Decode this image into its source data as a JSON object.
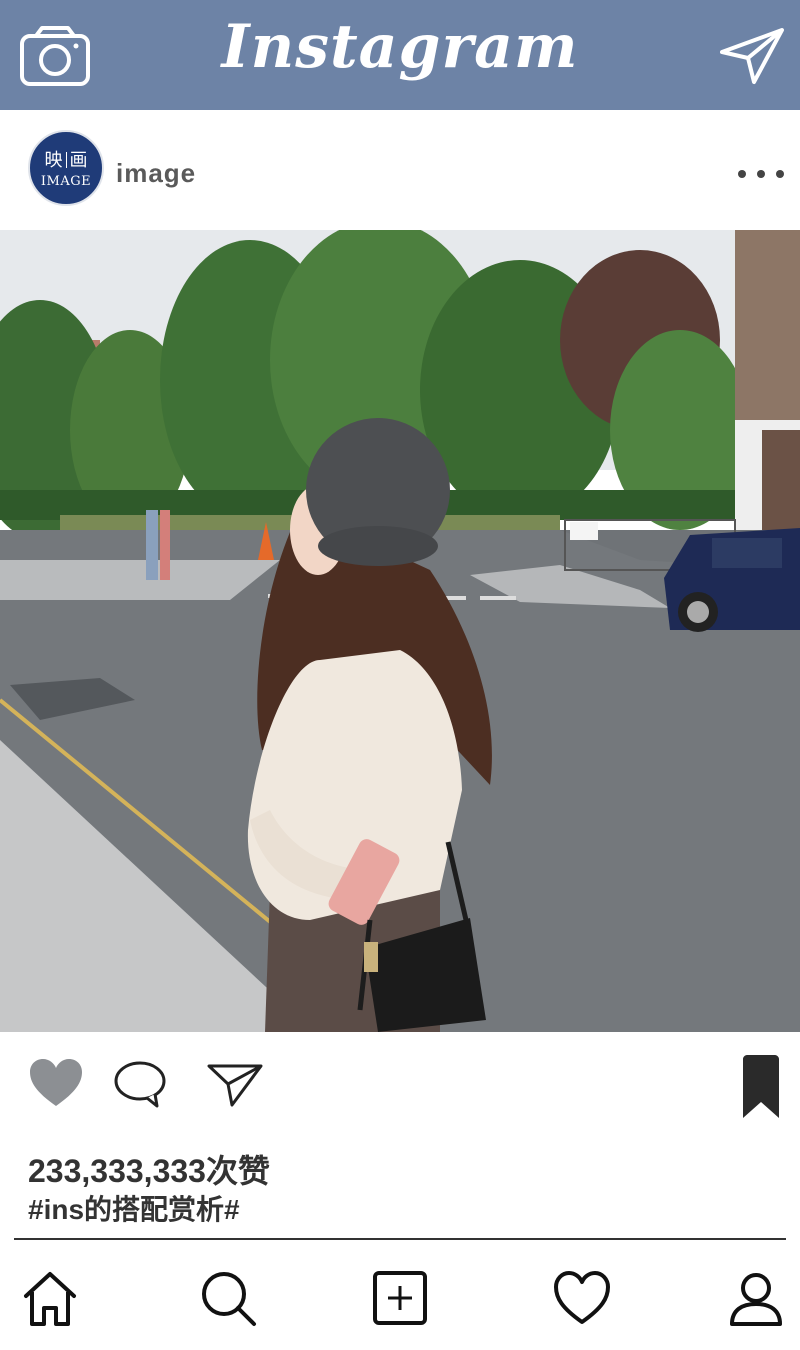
{
  "app": {
    "title": "Instagram"
  },
  "post": {
    "avatar_text_cn_1": "映",
    "avatar_text_cn_2": "画",
    "avatar_text_en": "IMAGE",
    "username": "image",
    "likes": "233,333,333次赞",
    "caption": "#ins的搭配赏析#"
  },
  "icons": {
    "top_left": "camera-icon",
    "top_right": "send-icon",
    "more": "more-dots-icon",
    "like": "heart-icon",
    "comment": "comment-icon",
    "share": "send-icon",
    "save": "bookmark-icon",
    "nav": [
      "home-icon",
      "search-icon",
      "add-post-icon",
      "heart-icon",
      "profile-icon"
    ]
  },
  "colors": {
    "topbar": "#6d83a6",
    "avatar": "#1f3b78",
    "icon_dark": "#222222",
    "liked_heart": "#8c8f93"
  }
}
